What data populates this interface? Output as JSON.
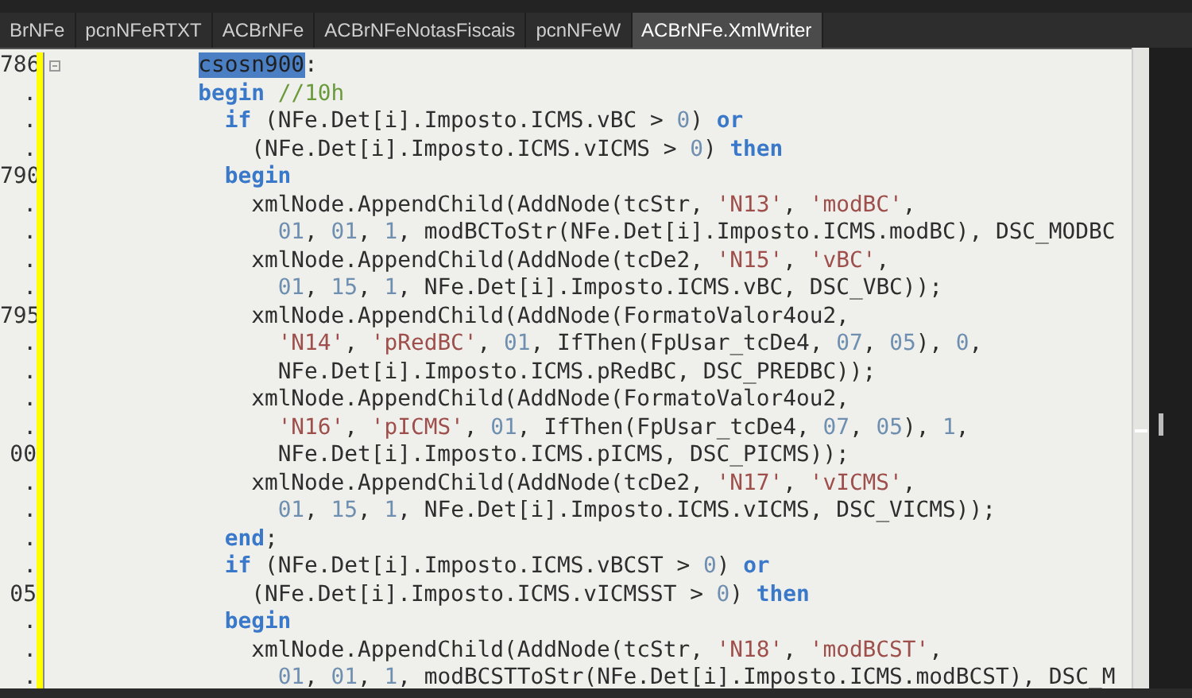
{
  "tabs": [
    {
      "label": "BrNFe",
      "selected": false
    },
    {
      "label": "pcnNFeRTXT",
      "selected": false
    },
    {
      "label": "ACBrNFe",
      "selected": false
    },
    {
      "label": "ACBrNFeNotasFiscais",
      "selected": false
    },
    {
      "label": "pcnNFeW",
      "selected": false
    },
    {
      "label": "ACBrNFe.XmlWriter",
      "selected": true
    }
  ],
  "editor": {
    "lines": [
      {
        "number": "786",
        "fold": true,
        "modified": true,
        "tokens": [
          {
            "kind": "selection",
            "text": "          csosn900"
          },
          {
            "kind": "plain",
            "text": ":"
          }
        ]
      },
      {
        "number": ".",
        "modified": true,
        "tokens": [
          {
            "kind": "keyword",
            "text": "          begin"
          },
          {
            "kind": "comment",
            "text": " //10h"
          }
        ]
      },
      {
        "number": ".",
        "modified": true,
        "tokens": [
          {
            "kind": "keyword",
            "text": "            if"
          },
          {
            "kind": "plain",
            "text": " (NFe.Det[i].Imposto.ICMS.vBC > "
          },
          {
            "kind": "number",
            "text": "0"
          },
          {
            "kind": "plain",
            "text": ") "
          },
          {
            "kind": "keyword",
            "text": "or"
          }
        ]
      },
      {
        "number": ".",
        "modified": true,
        "tokens": [
          {
            "kind": "plain",
            "text": "              (NFe.Det[i].Imposto.ICMS.vICMS > "
          },
          {
            "kind": "number",
            "text": "0"
          },
          {
            "kind": "plain",
            "text": ") "
          },
          {
            "kind": "keyword",
            "text": "then"
          }
        ]
      },
      {
        "number": "790",
        "modified": true,
        "tokens": [
          {
            "kind": "keyword",
            "text": "            begin"
          }
        ]
      },
      {
        "number": ".",
        "modified": true,
        "tokens": [
          {
            "kind": "plain",
            "text": "              xmlNode.AppendChild(AddNode(tcStr, "
          },
          {
            "kind": "string",
            "text": "'N13'"
          },
          {
            "kind": "plain",
            "text": ", "
          },
          {
            "kind": "string",
            "text": "'modBC'"
          },
          {
            "kind": "plain",
            "text": ","
          }
        ]
      },
      {
        "number": ".",
        "modified": true,
        "tokens": [
          {
            "kind": "number",
            "text": "                01"
          },
          {
            "kind": "plain",
            "text": ", "
          },
          {
            "kind": "number",
            "text": "01"
          },
          {
            "kind": "plain",
            "text": ", "
          },
          {
            "kind": "number",
            "text": "1"
          },
          {
            "kind": "plain",
            "text": ", modBCToStr(NFe.Det[i].Imposto.ICMS.modBC), DSC_MODBC"
          }
        ]
      },
      {
        "number": ".",
        "modified": true,
        "tokens": [
          {
            "kind": "plain",
            "text": "              xmlNode.AppendChild(AddNode(tcDe2, "
          },
          {
            "kind": "string",
            "text": "'N15'"
          },
          {
            "kind": "plain",
            "text": ", "
          },
          {
            "kind": "string",
            "text": "'vBC'"
          },
          {
            "kind": "plain",
            "text": ","
          }
        ]
      },
      {
        "number": ".",
        "modified": true,
        "tokens": [
          {
            "kind": "number",
            "text": "                01"
          },
          {
            "kind": "plain",
            "text": ", "
          },
          {
            "kind": "number",
            "text": "15"
          },
          {
            "kind": "plain",
            "text": ", "
          },
          {
            "kind": "number",
            "text": "1"
          },
          {
            "kind": "plain",
            "text": ", NFe.Det[i].Imposto.ICMS.vBC, DSC_VBC));"
          }
        ]
      },
      {
        "number": "795",
        "modified": true,
        "tokens": [
          {
            "kind": "plain",
            "text": "              xmlNode.AppendChild(AddNode(FormatoValor4ou2,"
          }
        ]
      },
      {
        "number": ".",
        "modified": true,
        "tokens": [
          {
            "kind": "string",
            "text": "                'N14'"
          },
          {
            "kind": "plain",
            "text": ", "
          },
          {
            "kind": "string",
            "text": "'pRedBC'"
          },
          {
            "kind": "plain",
            "text": ", "
          },
          {
            "kind": "number",
            "text": "01"
          },
          {
            "kind": "plain",
            "text": ", IfThen(FpUsar_tcDe4, "
          },
          {
            "kind": "number",
            "text": "07"
          },
          {
            "kind": "plain",
            "text": ", "
          },
          {
            "kind": "number",
            "text": "05"
          },
          {
            "kind": "plain",
            "text": "), "
          },
          {
            "kind": "number",
            "text": "0"
          },
          {
            "kind": "plain",
            "text": ","
          }
        ]
      },
      {
        "number": ".",
        "modified": true,
        "tokens": [
          {
            "kind": "plain",
            "text": "                NFe.Det[i].Imposto.ICMS.pRedBC, DSC_PREDBC));"
          }
        ]
      },
      {
        "number": ".",
        "modified": true,
        "tokens": [
          {
            "kind": "plain",
            "text": "              xmlNode.AppendChild(AddNode(FormatoValor4ou2,"
          }
        ]
      },
      {
        "number": ".",
        "modified": true,
        "tokens": [
          {
            "kind": "string",
            "text": "                'N16'"
          },
          {
            "kind": "plain",
            "text": ", "
          },
          {
            "kind": "string",
            "text": "'pICMS'"
          },
          {
            "kind": "plain",
            "text": ", "
          },
          {
            "kind": "number",
            "text": "01"
          },
          {
            "kind": "plain",
            "text": ", IfThen(FpUsar_tcDe4, "
          },
          {
            "kind": "number",
            "text": "07"
          },
          {
            "kind": "plain",
            "text": ", "
          },
          {
            "kind": "number",
            "text": "05"
          },
          {
            "kind": "plain",
            "text": "), "
          },
          {
            "kind": "number",
            "text": "1"
          },
          {
            "kind": "plain",
            "text": ","
          }
        ]
      },
      {
        "number": "00",
        "modified": true,
        "tokens": [
          {
            "kind": "plain",
            "text": "                NFe.Det[i].Imposto.ICMS.pICMS, DSC_PICMS));"
          }
        ]
      },
      {
        "number": ".",
        "modified": true,
        "tokens": [
          {
            "kind": "plain",
            "text": "              xmlNode.AppendChild(AddNode(tcDe2, "
          },
          {
            "kind": "string",
            "text": "'N17'"
          },
          {
            "kind": "plain",
            "text": ", "
          },
          {
            "kind": "string",
            "text": "'vICMS'"
          },
          {
            "kind": "plain",
            "text": ","
          }
        ]
      },
      {
        "number": ".",
        "modified": true,
        "tokens": [
          {
            "kind": "number",
            "text": "                01"
          },
          {
            "kind": "plain",
            "text": ", "
          },
          {
            "kind": "number",
            "text": "15"
          },
          {
            "kind": "plain",
            "text": ", "
          },
          {
            "kind": "number",
            "text": "1"
          },
          {
            "kind": "plain",
            "text": ", NFe.Det[i].Imposto.ICMS.vICMS, DSC_VICMS));"
          }
        ]
      },
      {
        "number": ".",
        "modified": true,
        "tokens": [
          {
            "kind": "keyword",
            "text": "            end"
          },
          {
            "kind": "plain",
            "text": ";"
          }
        ]
      },
      {
        "number": ".",
        "modified": true,
        "tokens": [
          {
            "kind": "keyword",
            "text": "            if"
          },
          {
            "kind": "plain",
            "text": " (NFe.Det[i].Imposto.ICMS.vBCST > "
          },
          {
            "kind": "number",
            "text": "0"
          },
          {
            "kind": "plain",
            "text": ") "
          },
          {
            "kind": "keyword",
            "text": "or"
          }
        ]
      },
      {
        "number": "05",
        "modified": true,
        "tokens": [
          {
            "kind": "plain",
            "text": "              (NFe.Det[i].Imposto.ICMS.vICMSST > "
          },
          {
            "kind": "number",
            "text": "0"
          },
          {
            "kind": "plain",
            "text": ") "
          },
          {
            "kind": "keyword",
            "text": "then"
          }
        ]
      },
      {
        "number": ".",
        "modified": true,
        "tokens": [
          {
            "kind": "keyword",
            "text": "            begin"
          }
        ]
      },
      {
        "number": ".",
        "modified": true,
        "tokens": [
          {
            "kind": "plain",
            "text": "              xmlNode.AppendChild(AddNode(tcStr, "
          },
          {
            "kind": "string",
            "text": "'N18'"
          },
          {
            "kind": "plain",
            "text": ", "
          },
          {
            "kind": "string",
            "text": "'modBCST'"
          },
          {
            "kind": "plain",
            "text": ","
          }
        ]
      },
      {
        "number": ".",
        "modified": true,
        "tokens": [
          {
            "kind": "number",
            "text": "                01"
          },
          {
            "kind": "plain",
            "text": ", "
          },
          {
            "kind": "number",
            "text": "01"
          },
          {
            "kind": "plain",
            "text": ", "
          },
          {
            "kind": "number",
            "text": "1"
          },
          {
            "kind": "plain",
            "text": ", modBCSTToStr(NFe.Det[i].Imposto.ICMS.modBCST), DSC_M"
          }
        ]
      }
    ]
  }
}
